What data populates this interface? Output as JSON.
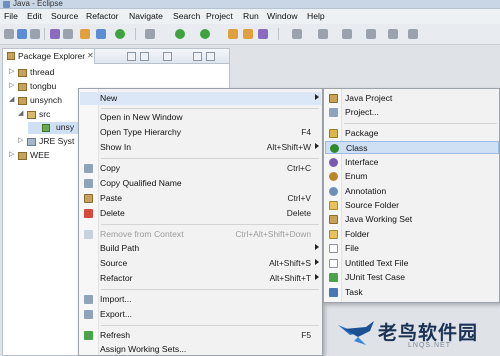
{
  "window": {
    "title": "Java - Eclipse"
  },
  "menubar": [
    "File",
    "Edit",
    "Source",
    "Refactor",
    "Navigate",
    "Search",
    "Project",
    "Run",
    "Window",
    "Help"
  ],
  "package_explorer": {
    "tab_label": "Package Explorer",
    "tree": [
      {
        "label": "thread"
      },
      {
        "label": "tongbu"
      },
      {
        "label": "unsynch"
      },
      {
        "label": "src"
      },
      {
        "label": "unsy"
      },
      {
        "label": "JRE Syst"
      },
      {
        "label": "WEE"
      }
    ]
  },
  "context_menu": {
    "items": [
      {
        "label": "New",
        "submenu": true
      },
      {
        "label": "Open in New Window"
      },
      {
        "label": "Open Type Hierarchy",
        "accel": "F4"
      },
      {
        "label": "Show In",
        "accel": "Alt+Shift+W",
        "submenu": true
      },
      {
        "label": "Copy",
        "accel": "Ctrl+C"
      },
      {
        "label": "Copy Qualified Name"
      },
      {
        "label": "Paste",
        "accel": "Ctrl+V"
      },
      {
        "label": "Delete",
        "accel": "Delete"
      },
      {
        "label": "Remove from Context",
        "accel": "Ctrl+Alt+Shift+Down",
        "disabled": true
      },
      {
        "label": "Build Path",
        "submenu": true
      },
      {
        "label": "Source",
        "accel": "Alt+Shift+S",
        "submenu": true
      },
      {
        "label": "Refactor",
        "accel": "Alt+Shift+T",
        "submenu": true
      },
      {
        "label": "Import..."
      },
      {
        "label": "Export..."
      },
      {
        "label": "Refresh",
        "accel": "F5"
      },
      {
        "label": "Assign Working Sets..."
      }
    ]
  },
  "new_submenu": {
    "items": [
      {
        "label": "Java Project"
      },
      {
        "label": "Project..."
      },
      {
        "label": "Package"
      },
      {
        "label": "Class",
        "highlighted": true
      },
      {
        "label": "Interface"
      },
      {
        "label": "Enum"
      },
      {
        "label": "Annotation"
      },
      {
        "label": "Source Folder"
      },
      {
        "label": "Java Working Set"
      },
      {
        "label": "Folder"
      },
      {
        "label": "File"
      },
      {
        "label": "Untitled Text File"
      },
      {
        "label": "JUnit Test Case"
      },
      {
        "label": "Task"
      }
    ]
  },
  "watermark": {
    "cn": "老鸟软件园",
    "en": "LNQS.NET"
  }
}
